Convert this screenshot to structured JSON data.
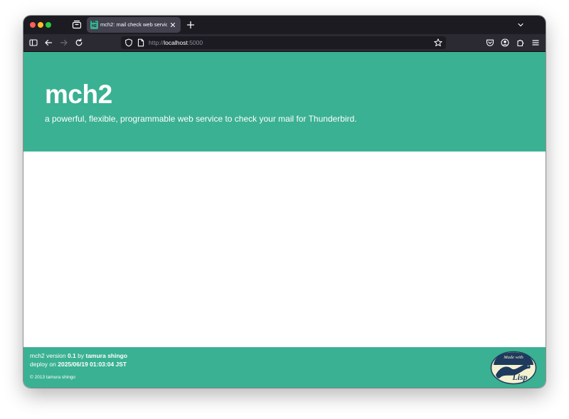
{
  "browser": {
    "tab": {
      "favicon_text": "MC H2",
      "title": "mch2: mail check web service"
    },
    "url": {
      "scheme": "http://",
      "host": "localhost",
      "port": ":5000"
    },
    "icons": {
      "tab_overview": "tab-overview-icon",
      "close_tab": "close-icon",
      "new_tab": "plus-icon",
      "tab_list": "chevron-down-icon",
      "sidebar": "sidebar-icon",
      "back": "back-arrow-icon",
      "forward": "forward-arrow-icon",
      "reload": "reload-icon",
      "tracking_protection": "shield-icon",
      "page_info": "page-icon",
      "bookmark": "star-icon",
      "pocket": "pocket-icon",
      "account": "account-icon",
      "extensions": "puzzle-icon",
      "menu": "hamburger-menu-icon"
    },
    "colors": {
      "tabstrip": "#1c1b22",
      "toolbar": "#2b2a33",
      "active_tab": "#42414d"
    }
  },
  "page": {
    "header": {
      "title": "mch2",
      "subtitle": "a powerful, flexible, programmable web service to check your mail for Thunderbird."
    },
    "footer": {
      "version_prefix": "mch2 version",
      "version": "0.1",
      "by_text": "by",
      "author": "tamura shingo",
      "deploy_prefix": "deploy on",
      "deploy_date": "2025/06/19 01:03:04 JST",
      "copyright": "© 2013 tamura shingo",
      "badge": {
        "top_text": "Made with",
        "main_text": "Lisp"
      }
    },
    "colors": {
      "accent": "#3ab192",
      "text_on_accent": "#ffffff"
    }
  }
}
